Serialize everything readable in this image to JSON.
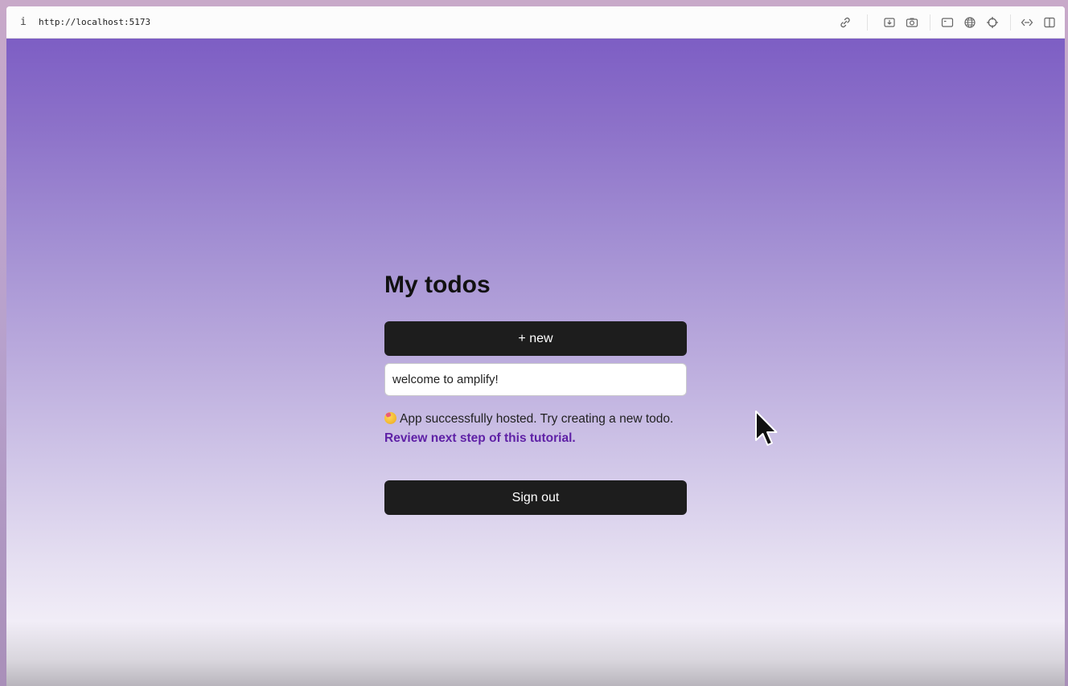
{
  "browser": {
    "info_icon": "i",
    "url": "http://localhost:5173",
    "icons": [
      "link-icon",
      "download-icon",
      "camera-icon",
      "terminal-icon",
      "globe-icon",
      "crosshair-icon",
      "code-icon",
      "split-view-icon"
    ]
  },
  "app": {
    "title": "My todos",
    "new_button_label": "+ new",
    "todos": [
      {
        "content": "welcome to amplify!"
      }
    ],
    "message": "App successfully hosted. Try creating a new todo.",
    "tutorial_link": "Review next step of this tutorial.",
    "signout_label": "Sign out"
  },
  "colors": {
    "gradient_top": "#7d5ec4",
    "gradient_bottom": "#f1edf7",
    "button_bg": "#1d1d1d",
    "link": "#5f21a6"
  }
}
